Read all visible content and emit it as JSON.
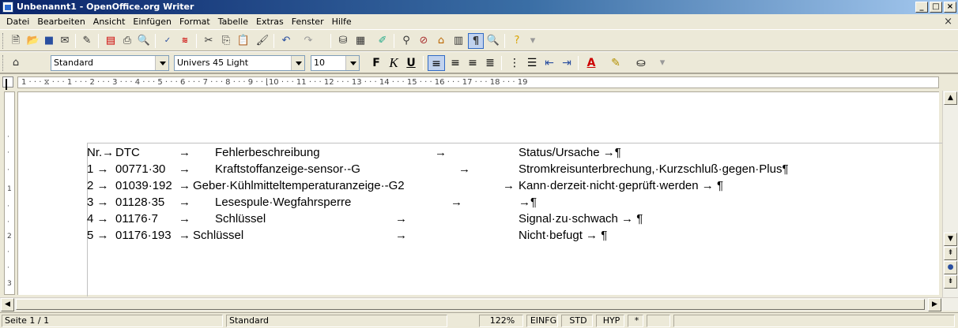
{
  "window": {
    "title": "Unbenannt1 - OpenOffice.org Writer",
    "controls": {
      "minimize": "_",
      "maximize": "□",
      "close": "×"
    }
  },
  "menu": {
    "items": [
      "Datei",
      "Bearbeiten",
      "Ansicht",
      "Einfügen",
      "Format",
      "Tabelle",
      "Extras",
      "Fenster",
      "Hilfe"
    ],
    "close_doc": "×"
  },
  "toolbar_standard": {
    "icons": [
      "new-document-icon",
      "open-icon",
      "save-icon",
      "email-icon",
      "edit-file-icon",
      "export-pdf-icon",
      "print-icon",
      "page-preview-icon",
      "spellcheck-icon",
      "autospellcheck-icon",
      "cut-icon",
      "copy-icon",
      "paste-icon",
      "clone-formatting-icon",
      "undo-icon",
      "redo-icon",
      "navigator-icon",
      "table-icon",
      "draw-functions-icon",
      "find-replace-icon",
      "navigator-compass-icon",
      "gallery-icon",
      "data-sources-icon",
      "formatting-marks-icon",
      "zoom-icon",
      "help-icon"
    ]
  },
  "toolbar_formatting": {
    "style": "Standard",
    "font": "Univers 45 Light",
    "size": "10",
    "bold": "F",
    "italic": "K",
    "underline": "U"
  },
  "ruler": {
    "text": "1 · · · ⧖ · · · 1 · · · 2 · · · 3 · · · 4 · · · 5 · · · 6 · · · 7 · · · 8 · · · 9 · · ⌊10 · · · 11 · · · 12 · · · 13 · · · 14 · · · 15 · · · 16 · · · 17 · · · 18 · · · 19"
  },
  "document": {
    "rows": [
      [
        "Nr.→",
        "DTC",
        "→",
        "Fehlerbeschreibung",
        "→",
        "Status/Ursache →¶"
      ],
      [
        "1 →",
        "00771·30",
        "→",
        "Kraftstoffanzeige-sensor·-G",
        "→",
        "Stromkreisunterbrechung,·Kurzschluß·gegen·Plus¶"
      ],
      [
        "2 →",
        "01039·192",
        "→",
        "Geber·Kühlmitteltemperaturanzeige·-G2",
        "→",
        "Kann·derzeit·nicht·geprüft·werden  →  ¶"
      ],
      [
        "3 →",
        "01128·35",
        "→",
        "Lesespule·Wegfahrsperre",
        "→",
        "→¶"
      ],
      [
        "4 →",
        "01176·7",
        "→",
        "Schlüssel",
        "→",
        "Signal·zu·schwach  →  ¶"
      ],
      [
        "5 →",
        "01176·193",
        "→",
        "Schlüssel",
        "→",
        "Nicht·befugt  →  ¶"
      ]
    ]
  },
  "statusbar": {
    "page": "Seite 1 / 1",
    "style": "Standard",
    "zoom": "122%",
    "insert_mode": "EINFG",
    "selection_mode": "STD",
    "hyperlink_mode": "HYP",
    "modified": "*"
  }
}
